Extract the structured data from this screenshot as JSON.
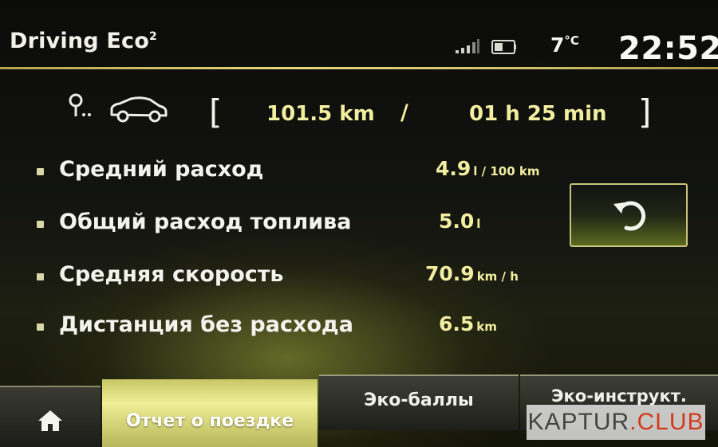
{
  "header": {
    "title": "Driving Eco",
    "title_sup": "2",
    "temperature": "7",
    "temperature_unit": "°C",
    "clock": "22:52"
  },
  "trip": {
    "bracket_left": "[",
    "bracket_right": "]",
    "distance": "101.5 km",
    "separator": "/",
    "duration": "01 h 25 min"
  },
  "stats": [
    {
      "label": "Средний расход",
      "value": "4.9",
      "unit": "l / 100 km"
    },
    {
      "label": "Общий расход топлива",
      "value": "5.0",
      "unit": "l"
    },
    {
      "label": "Средняя скорость",
      "value": "70.9",
      "unit": "km / h"
    },
    {
      "label": "Дистанция без расхода",
      "value": "6.5",
      "unit": "km"
    }
  ],
  "tabs": {
    "home": "home-icon",
    "report": "Отчет о поездке",
    "ecopoints": "Эко-баллы",
    "ecoinstruct": "Эко-инструкт."
  },
  "watermark": {
    "brand": "KAPTUR",
    "suffix": ".CLUB"
  },
  "colors": {
    "accent_value": "#f2eea0",
    "active_tab": "#f0ee96",
    "watermark_red": "#d33a1c"
  }
}
